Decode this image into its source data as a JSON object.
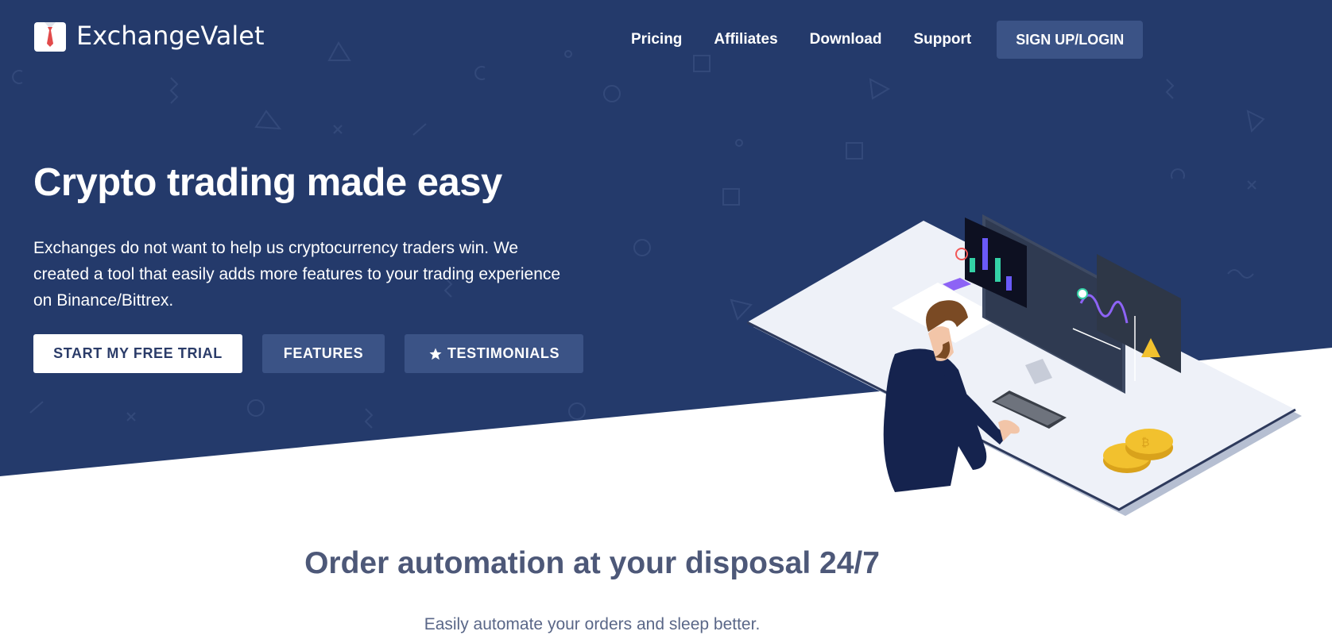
{
  "brand": {
    "name": "ExchangeValet",
    "icon": "suit-tie-logo-icon"
  },
  "nav": {
    "links": [
      "Pricing",
      "Affiliates",
      "Download",
      "Support"
    ],
    "cta": "SIGN UP/LOGIN"
  },
  "hero": {
    "title": "Crypto trading made easy",
    "description": "Exchanges do not want to help us cryptocurrency traders win. We created a tool that easily adds more features to your trading experience on Binance/Bittrex.",
    "buttons": {
      "trial": "START MY FREE TRIAL",
      "features": "FEATURES",
      "testimonials": "TESTIMONIALS",
      "testimonials_icon": "star-icon"
    },
    "illustration": "trader-at-desk-illustration"
  },
  "section": {
    "title": "Order automation at your disposal 24/7",
    "subtitle": "Easily automate your orders and sleep better."
  },
  "colors": {
    "navy": "#243a6b",
    "button_secondary": "#3b5386",
    "heading_muted": "#4d5878",
    "coin_gold": "#f2c12e"
  }
}
